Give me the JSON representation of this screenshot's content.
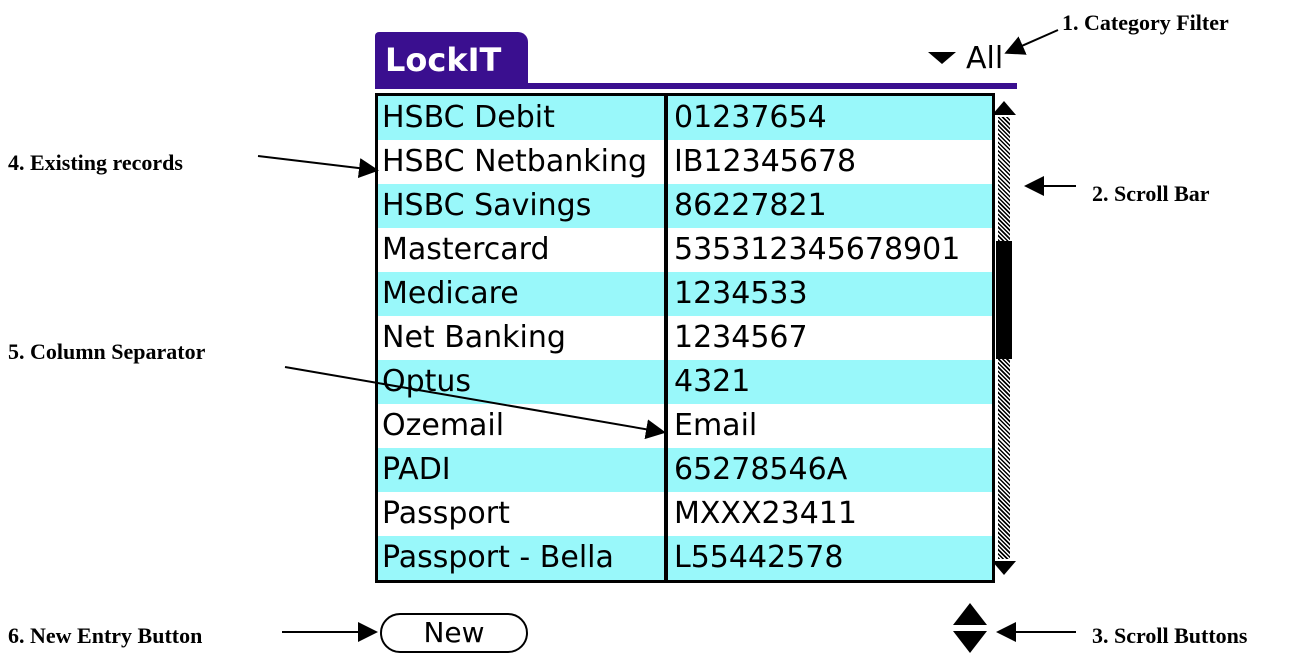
{
  "app": {
    "title": "LockIT",
    "category_filter": "All"
  },
  "records": [
    {
      "name": "HSBC Debit",
      "value": "01237654"
    },
    {
      "name": "HSBC Netbanking",
      "value": "IB12345678"
    },
    {
      "name": "HSBC Savings",
      "value": "86227821"
    },
    {
      "name": "Mastercard",
      "value": "535312345678901"
    },
    {
      "name": "Medicare",
      "value": "1234533"
    },
    {
      "name": "Net Banking",
      "value": "1234567"
    },
    {
      "name": "Optus",
      "value": "4321"
    },
    {
      "name": "Ozemail",
      "value": "Email"
    },
    {
      "name": "PADI",
      "value": "65278546A"
    },
    {
      "name": "Passport",
      "value": "MXXX23411"
    },
    {
      "name": "Passport - Bella",
      "value": "L55442578"
    }
  ],
  "buttons": {
    "new_label": "New"
  },
  "annotations": {
    "category_filter": "1. Category Filter",
    "scroll_bar": "2. Scroll Bar",
    "scroll_buttons": "3. Scroll Buttons",
    "existing_records": "4. Existing records",
    "column_separator": "5. Column Separator",
    "new_entry_button": "6. New Entry Button"
  },
  "colors": {
    "title_bar": "#3a0f8f",
    "alt_row": "#99f8fa"
  }
}
